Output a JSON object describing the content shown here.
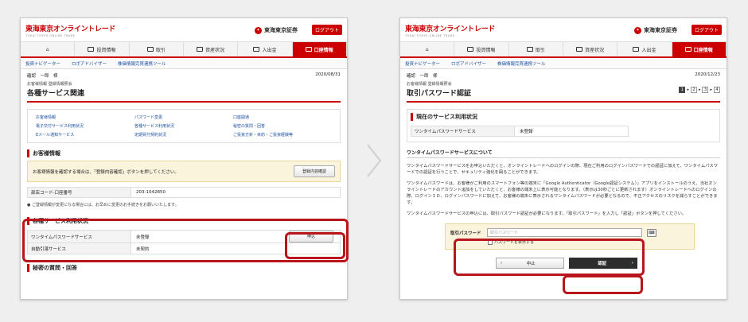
{
  "header": {
    "logo_main": "東海東京オンライントレード",
    "logo_sub": "TOKAI TOKYO ONLINE TRADE",
    "brand_mark": "✦",
    "brand": "東海東京証券",
    "logout": "ログアウト"
  },
  "nav": {
    "home_icon": "home-icon",
    "items": [
      "投資情報",
      "取引",
      "資産状況",
      "入出金",
      "口座情報"
    ]
  },
  "subnav": [
    "投資ナビゲーター",
    "ロボアドバイザー",
    "株価情報完買連携ツール"
  ],
  "left": {
    "user": "確認　一郎　様",
    "date": "2020/08/31",
    "breadcrumb": "お客様情報 登録情報照会",
    "title": "各種サービス関連",
    "links": [
      "お客様情報",
      "パスワード変更",
      "口座開通",
      "電子交付サービス利用状況",
      "各種サービス利用状況",
      "秘密の質問・回答",
      "Eメール通知サービス",
      "定期買付契約状況",
      "ご投資方針・目的・ご投資経験等"
    ],
    "sec1": "お客様情報",
    "notice": "お客様情報を確認する場合は、「登録内容確認」ボタンを押してください。",
    "confirm_btn": "登録内容確認",
    "acct_label": "部店コード-口座番号",
    "acct_value": "203-1042850",
    "warn": "ご登録情報が変更になる場合には、お早めに変更のお手続きをお願いいたします。",
    "sec2": "各種サービス利用状況",
    "svc_label": "ワンタイムパスワードサービス",
    "svc_value": "未登録",
    "apply_btn": "申込",
    "svc2_label": "自動引落サービス",
    "svc2_value": "未契約",
    "sec3": "秘密の質問・回答"
  },
  "right": {
    "user": "確認　一郎　様",
    "date": "2020/12/23",
    "breadcrumb": "お客様情報 登録情報照会",
    "title": "取引パスワード認証",
    "steps": [
      "1",
      "2",
      "3",
      "4"
    ],
    "sec1": "現在のサービス利用状況",
    "svc_label": "ワンタイムパスワードサービス",
    "svc_value": "未登録",
    "about_title": "ワンタイムパスワードサービスについて",
    "para1": "ワンタイムパスワードサービスをお申込いただくと、オンライントレードへのログインの際、現在ご利用のログインパスワードでの認証に加えて、ワンタイムパスワードでの認証を行うことで、セキュリティ強化を図ることができます。",
    "para2": "ワンタイムパスワードは、お客様がご利用のスマートフォン等の端末に「Google Authenticator（Google認証システム）」アプリをインストールのうえ、当社オンライントレードのアカウント追加をしていただくと、お客様の端末上に表示可能となります。（表示は30秒ごとに更新されます）オンライントレードへのログインの際、ログインＩＤ、ログインパスワードに加えて、お客様の端末に表示されるワンタイムパスワードが必要となるので、不正アクセスのリスクを減らすことができます。",
    "para3": "ワンタイムパスワードサービスの申込には、取引パスワード認証が必要になります。「取引パスワード」を入力し「認証」ボタンを押してください。",
    "pw_label": "取引パスワード",
    "pw_placeholder": "取引パスワード",
    "keyboard_icon": "keyboard-icon",
    "show_pw": "パスワードを表示する",
    "cancel_btn": "中止",
    "submit_btn": "認証"
  }
}
